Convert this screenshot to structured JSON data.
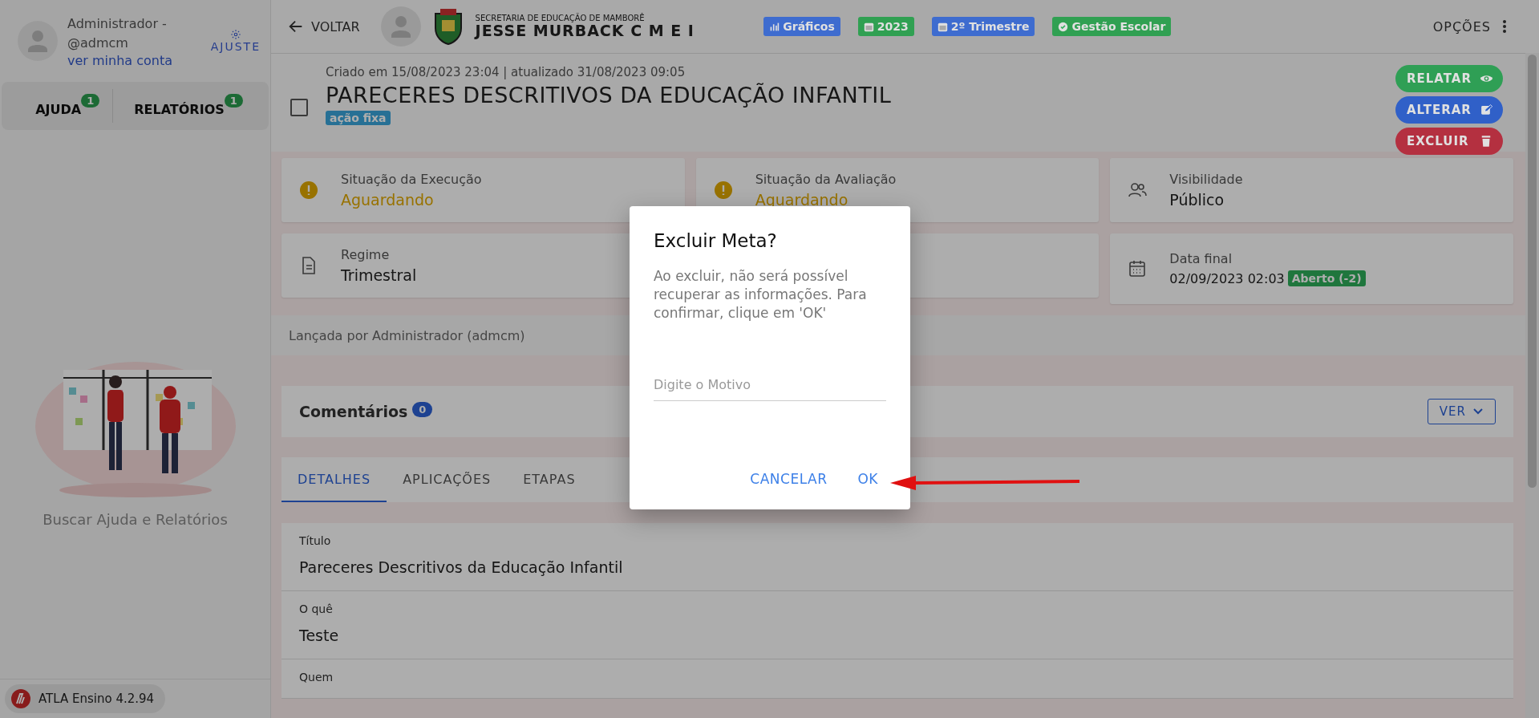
{
  "sidebar": {
    "user_name": "Administrador - @admcm",
    "account_link": "ver minha conta",
    "settings_label": "AJUSTE",
    "tabs": [
      {
        "label": "AJUDA",
        "count": "1"
      },
      {
        "label": "RELATÓRIOS",
        "count": "1"
      }
    ],
    "help_caption": "Buscar Ajuda e Relatórios",
    "version": "ATLA Ensino 4.2.94"
  },
  "header": {
    "back": "VOLTAR",
    "school_subtitle": "SECRETARIA DE EDUCAÇÃO DE MAMBORÊ",
    "school_name": "JESSE MURBACK C M E I",
    "chips": [
      {
        "label": "Gráficos",
        "kind": "chart",
        "color": "#3e6ccf"
      },
      {
        "label": "2023",
        "kind": "calendar",
        "color": "#30a052"
      },
      {
        "label": "2º Trimestre",
        "kind": "calendar",
        "color": "#3e6ccf"
      },
      {
        "label": "Gestão Escolar",
        "kind": "check",
        "color": "#30a052"
      }
    ],
    "options": "OPÇÕES"
  },
  "record": {
    "meta": "Criado em 15/08/2023 23:04 | atualizado 31/08/2023 09:05",
    "title": "PARECERES DESCRITIVOS DA EDUCAÇÃO INFANTIL",
    "tag": "ação fixa",
    "checked": false,
    "actions": [
      {
        "label": "RELATAR",
        "kind": "eye",
        "color": "#2f9f55"
      },
      {
        "label": "ALTERAR",
        "kind": "edit",
        "color": "#3060c8"
      },
      {
        "label": "EXCLUIR",
        "kind": "trash",
        "color": "#b43040"
      }
    ]
  },
  "info_cards": [
    {
      "kind": "warning",
      "label": "Situação da Execução",
      "value": "Aguardando"
    },
    {
      "kind": "warning",
      "label": "Situação da Avaliação",
      "value": "Aguardando"
    },
    {
      "kind": "people",
      "label": "Visibilidade",
      "value": "Público"
    },
    {
      "kind": "document",
      "label": "Regime",
      "value": "Trimestral"
    },
    {
      "kind": "covered"
    },
    {
      "kind": "calendar",
      "label": "Data final",
      "value": "02/09/2023 02:03",
      "badge": "Aberto (-2)"
    }
  ],
  "launched_by": "Lançada por Administrador (admcm)",
  "comments": {
    "label": "Comentários",
    "count": "0",
    "button": "VER"
  },
  "tabs": [
    {
      "label": "DETALHES",
      "selected": true
    },
    {
      "label": "APLICAÇÕES",
      "selected": false
    },
    {
      "label": "ETAPAS",
      "selected": false
    }
  ],
  "fields": [
    {
      "label": "Título",
      "value": "Pareceres Descritivos da Educação Infantil"
    },
    {
      "label": "O quê",
      "value": "Teste"
    },
    {
      "label": "Quem"
    }
  ],
  "dialog": {
    "title": "Excluir Meta?",
    "message": "Ao excluir, não será possível recuperar as informações. Para confirmar, clique em 'OK'",
    "placeholder": "Digite o Motivo",
    "buttons": [
      "CANCELAR",
      "OK"
    ]
  }
}
